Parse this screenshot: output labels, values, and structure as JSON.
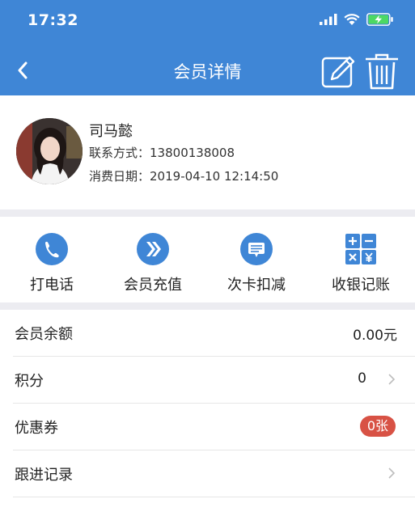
{
  "status_bar": {
    "time": "17:32"
  },
  "header": {
    "title": "会员详情"
  },
  "member": {
    "name": "司马懿",
    "contact_label": "联系方式：",
    "phone": "13800138008",
    "date_label": "消费日期：",
    "date": "2019-04-10 12:14:50"
  },
  "actions": [
    {
      "label": "打电话",
      "icon": "phone-icon"
    },
    {
      "label": "会员充值",
      "icon": "recharge-icon"
    },
    {
      "label": "次卡扣减",
      "icon": "card-deduct-icon"
    },
    {
      "label": "收银记账",
      "icon": "calculator-icon"
    }
  ],
  "rows": {
    "balance": {
      "label": "会员余额",
      "value": "0.00元"
    },
    "points": {
      "label": "积分",
      "value": "0"
    },
    "coupons": {
      "label": "优惠券",
      "value": "0张"
    },
    "followup": {
      "label": "跟进记录"
    }
  },
  "colors": {
    "primary": "#3f86d6",
    "badge": "#d85245",
    "background": "#ececf1"
  }
}
